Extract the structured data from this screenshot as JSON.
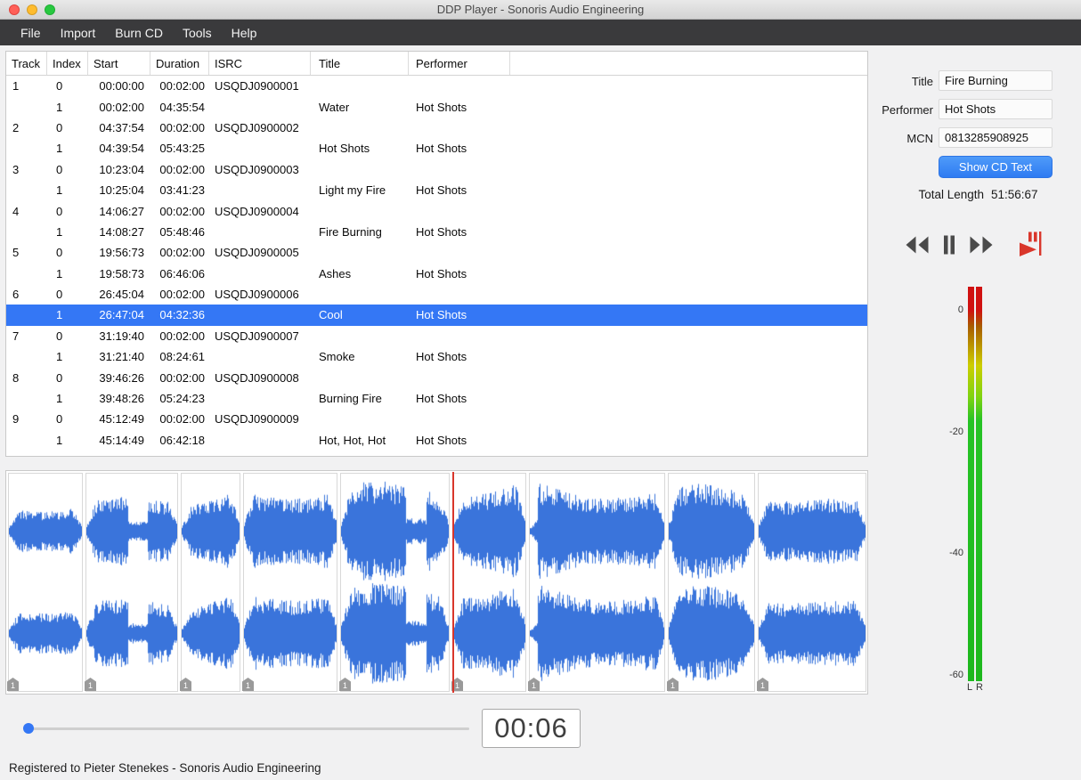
{
  "window": {
    "title": "DDP Player - Sonoris Audio Engineering",
    "status_bar": "Registered to Pieter Stenekes - Sonoris Audio Engineering"
  },
  "menu": {
    "items": [
      "File",
      "Import",
      "Burn CD",
      "Tools",
      "Help"
    ]
  },
  "table": {
    "columns": [
      "Track",
      "Index",
      "Start",
      "Duration",
      "ISRC",
      "Title",
      "Performer"
    ],
    "rows": [
      {
        "cells": [
          "1",
          "0",
          "00:00:00",
          "00:02:00",
          "USQDJ0900001",
          "",
          ""
        ],
        "selected": false
      },
      {
        "cells": [
          "",
          "1",
          "00:02:00",
          "04:35:54",
          "",
          "Water",
          "Hot Shots"
        ],
        "selected": false
      },
      {
        "cells": [
          "2",
          "0",
          "04:37:54",
          "00:02:00",
          "USQDJ0900002",
          "",
          ""
        ],
        "selected": false
      },
      {
        "cells": [
          "",
          "1",
          "04:39:54",
          "05:43:25",
          "",
          "Hot Shots",
          "Hot Shots"
        ],
        "selected": false
      },
      {
        "cells": [
          "3",
          "0",
          "10:23:04",
          "00:02:00",
          "USQDJ0900003",
          "",
          ""
        ],
        "selected": false
      },
      {
        "cells": [
          "",
          "1",
          "10:25:04",
          "03:41:23",
          "",
          "Light my Fire",
          "Hot Shots"
        ],
        "selected": false
      },
      {
        "cells": [
          "4",
          "0",
          "14:06:27",
          "00:02:00",
          "USQDJ0900004",
          "",
          ""
        ],
        "selected": false
      },
      {
        "cells": [
          "",
          "1",
          "14:08:27",
          "05:48:46",
          "",
          "Fire Burning",
          "Hot Shots"
        ],
        "selected": false
      },
      {
        "cells": [
          "5",
          "0",
          "19:56:73",
          "00:02:00",
          "USQDJ0900005",
          "",
          ""
        ],
        "selected": false
      },
      {
        "cells": [
          "",
          "1",
          "19:58:73",
          "06:46:06",
          "",
          "Ashes",
          "Hot Shots"
        ],
        "selected": false
      },
      {
        "cells": [
          "6",
          "0",
          "26:45:04",
          "00:02:00",
          "USQDJ0900006",
          "",
          ""
        ],
        "selected": false
      },
      {
        "cells": [
          "",
          "1",
          "26:47:04",
          "04:32:36",
          "",
          "Cool",
          "Hot Shots"
        ],
        "selected": true
      },
      {
        "cells": [
          "7",
          "0",
          "31:19:40",
          "00:02:00",
          "USQDJ0900007",
          "",
          ""
        ],
        "selected": false
      },
      {
        "cells": [
          "",
          "1",
          "31:21:40",
          "08:24:61",
          "",
          "Smoke",
          "Hot Shots"
        ],
        "selected": false
      },
      {
        "cells": [
          "8",
          "0",
          "39:46:26",
          "00:02:00",
          "USQDJ0900008",
          "",
          ""
        ],
        "selected": false
      },
      {
        "cells": [
          "",
          "1",
          "39:48:26",
          "05:24:23",
          "",
          "Burning Fire",
          "Hot Shots"
        ],
        "selected": false
      },
      {
        "cells": [
          "9",
          "0",
          "45:12:49",
          "00:02:00",
          "USQDJ0900009",
          "",
          ""
        ],
        "selected": false
      },
      {
        "cells": [
          "",
          "1",
          "45:14:49",
          "06:42:18",
          "",
          "Hot, Hot, Hot",
          "Hot Shots"
        ],
        "selected": false
      }
    ]
  },
  "side_panel": {
    "title_label": "Title",
    "title_value": "Fire Burning",
    "performer_label": "Performer",
    "performer_value": "Hot Shots",
    "mcn_label": "MCN",
    "mcn_value": "0813285908925",
    "show_cd_text_button": "Show CD Text",
    "total_length_label": "Total Length",
    "total_length_value": "51:56:67",
    "meter": {
      "scale_labels": [
        "0",
        "-20",
        "-40",
        "-60"
      ],
      "channel_labels": [
        "L",
        "R"
      ]
    }
  },
  "transport": {
    "time_display": "00:06",
    "buttons": [
      "rewind",
      "pause",
      "fast-forward",
      "play-to-marker"
    ]
  },
  "waveform": {
    "marker_label": "1"
  },
  "colors": {
    "selection_blue": "#3477F5",
    "waveform_blue": "#3A74DB",
    "playhead_red": "#D9362B",
    "button_blue": "#3D8BF8",
    "meter_red": "#D01111",
    "meter_yellow": "#CCCE00",
    "meter_green": "#1DB81D"
  }
}
